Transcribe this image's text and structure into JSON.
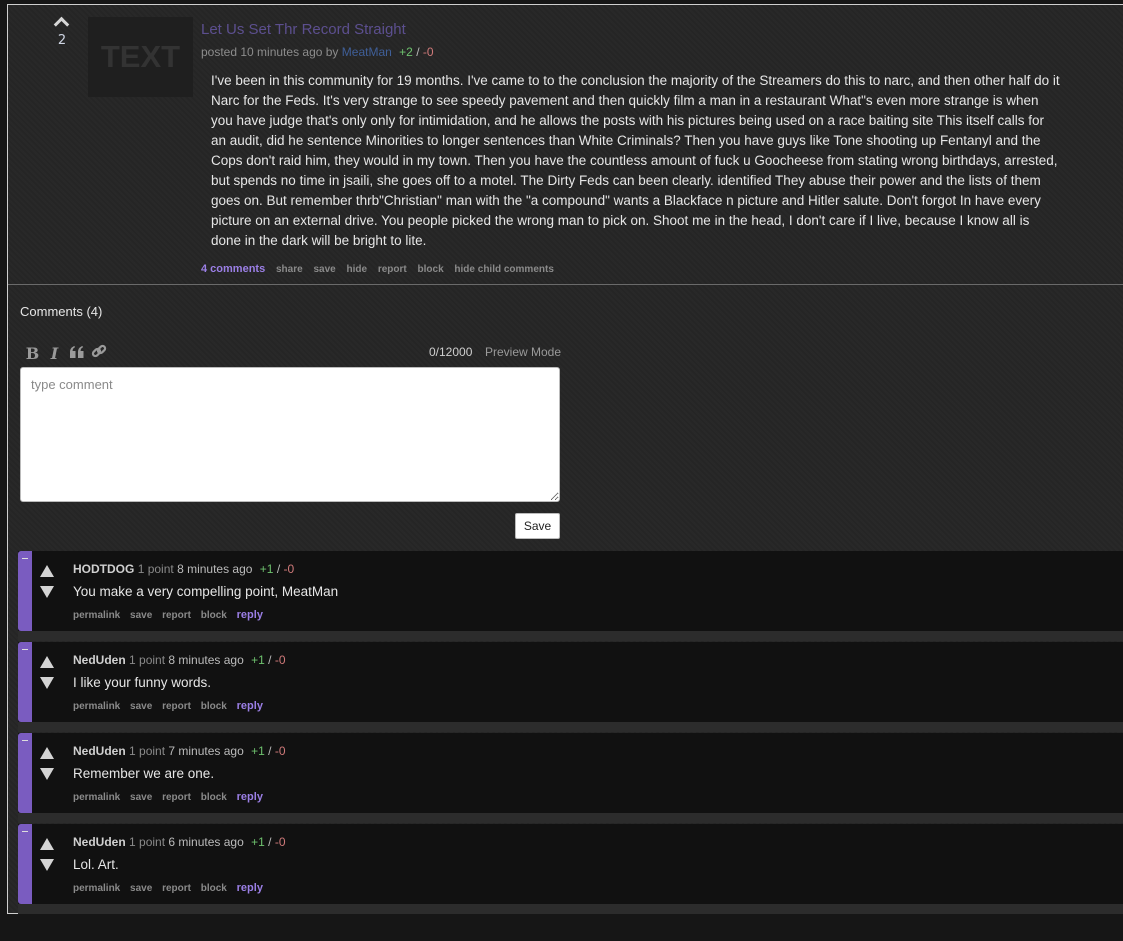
{
  "post": {
    "score": "2",
    "thumbnail_text": "TEXT",
    "title": "Let Us Set Thr Record Straight",
    "meta": {
      "posted_prefix": "posted 10 minutes ago by",
      "author": "MeatMan",
      "upvotes": "+2",
      "separator": "/",
      "downvotes": "-0"
    },
    "body": "I've been in this community for 19 months. I've came to to the conclusion the majority of the Streamers do this to narc, and then other half do it Narc for the Feds. It's very strange to see speedy pavement and then quickly film a man in a restaurant What\"s even more strange is when you have judge that's only only for intimidation, and he allows the posts with his pictures being used on a race baiting site This itself calls for an audit, did he sentence Minorities to longer sentences than White Criminals? Then you have guys like Tone shooting up Fentanyl and the Cops don't raid him, they would in my town. Then you have the countless amount of fuck u Goocheese from stating wrong birthdays, arrested, but spends no time in jsaili, she goes off to a motel. The Dirty Feds can been clearly. identified They abuse their power and the lists of them goes on. But remember thrb\"Christian\" man with the \"a compound\" wants a Blackface n picture and Hitler salute. Don't forgot In have every picture on an external drive. You people picked the wrong man to pick on. Shoot me in the head, I don't care if I live, because I know all is done in the dark will be bright to lite.",
    "actions": [
      "4 comments",
      "share",
      "save",
      "hide",
      "report",
      "block",
      "hide child comments"
    ]
  },
  "comments_section": {
    "title": "Comments (4)",
    "toolbar": {
      "bold": "B",
      "italic": "I",
      "quote": "❝",
      "link": "🔗"
    },
    "counter": "0/12000",
    "preview_mode": "Preview Mode",
    "placeholder": "type comment",
    "save_label": "Save"
  },
  "comments": [
    {
      "user": "HODTDOG",
      "points": "1 point",
      "time": "8 minutes ago",
      "upvotes": "+1",
      "separator": "/",
      "downvotes": "-0",
      "body": "You make a very compelling point, MeatMan",
      "actions": [
        "permalink",
        "save",
        "report",
        "block",
        "reply"
      ]
    },
    {
      "user": "NedUden",
      "points": "1 point",
      "time": "8 minutes ago",
      "upvotes": "+1",
      "separator": "/",
      "downvotes": "-0",
      "body": "I like your funny words.",
      "actions": [
        "permalink",
        "save",
        "report",
        "block",
        "reply"
      ]
    },
    {
      "user": "NedUden",
      "points": "1 point",
      "time": "7 minutes ago",
      "upvotes": "+1",
      "separator": "/",
      "downvotes": "-0",
      "body": "Remember we are one.",
      "actions": [
        "permalink",
        "save",
        "report",
        "block",
        "reply"
      ]
    },
    {
      "user": "NedUden",
      "points": "1 point",
      "time": "6 minutes ago",
      "upvotes": "+1",
      "separator": "/",
      "downvotes": "-0",
      "body": "Lol. Art.",
      "actions": [
        "permalink",
        "save",
        "report",
        "block",
        "reply"
      ]
    }
  ],
  "colors": {
    "accent_purple": "#7a5cc0",
    "link_purple": "#9b7fe6",
    "upvote_green": "#6ec26e",
    "downvote_red": "#d07a7a",
    "author_blue": "#3f5f99"
  }
}
